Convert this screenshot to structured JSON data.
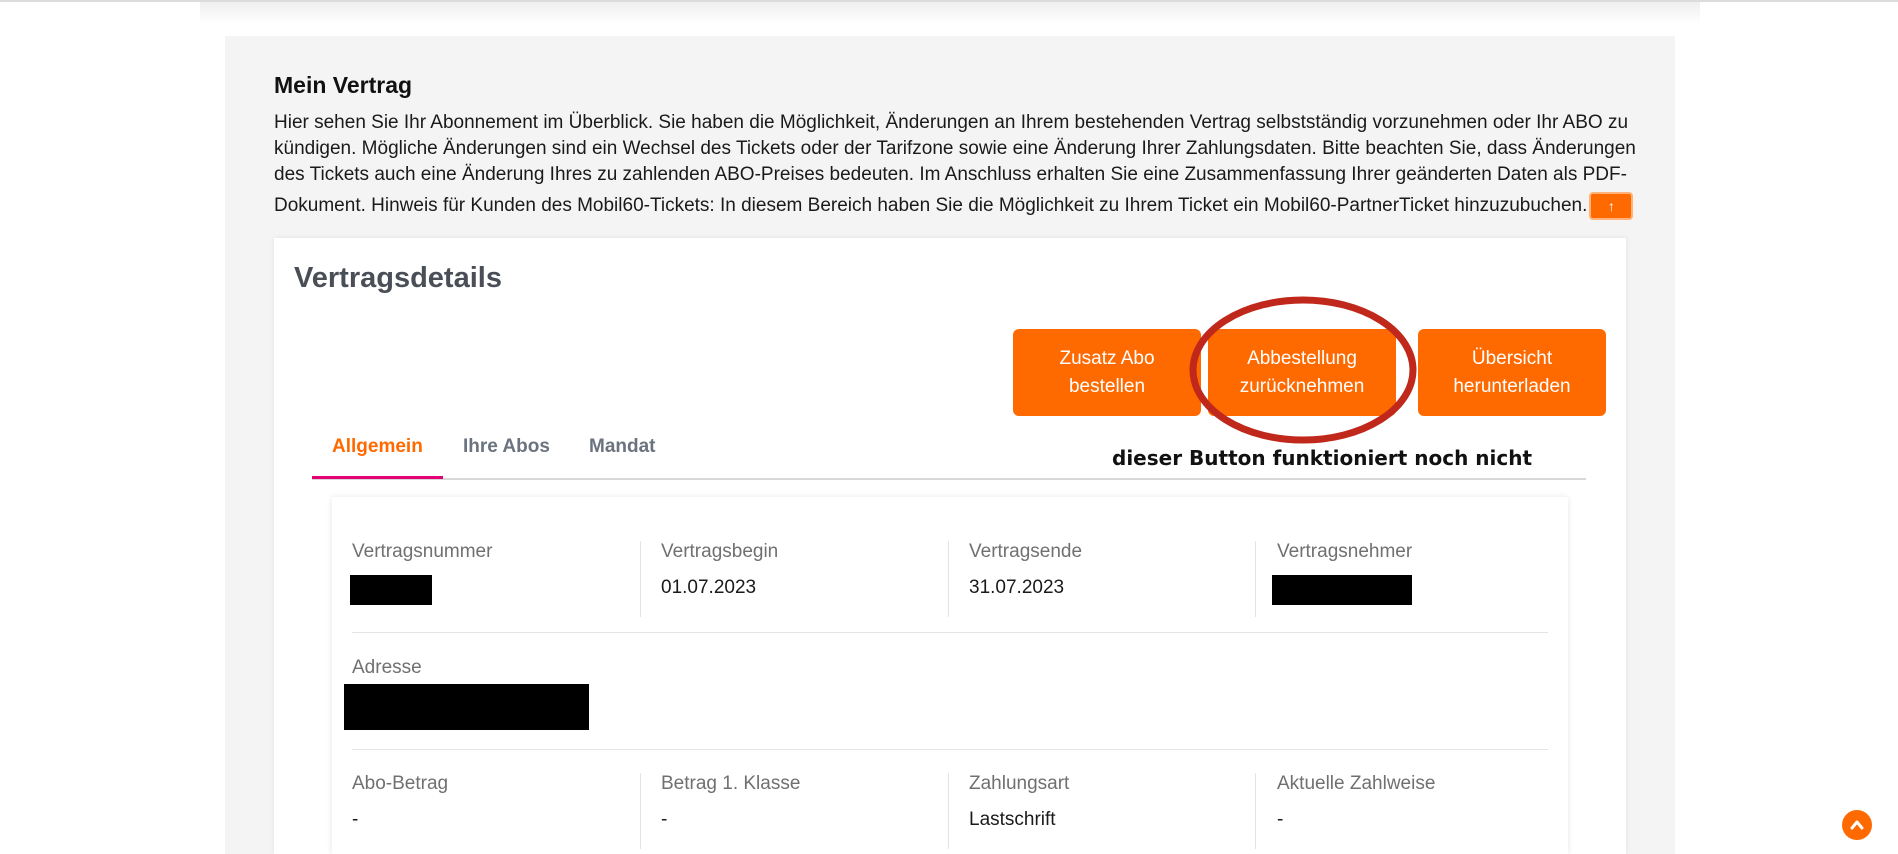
{
  "section": {
    "title": "Mein Vertrag",
    "intro_lines": [
      "Hier sehen Sie Ihr Abonnement im Überblick. Sie haben die Möglichkeit, Änderungen an Ihrem bestehenden Vertrag selbstständig vorzunehmen oder Ihr ABO zu",
      "kündigen. Mögliche Änderungen sind ein Wechsel des Tickets oder der Tarifzone sowie eine Änderung Ihrer Zahlungsdaten. Bitte beachten Sie, dass Änderungen",
      "des Tickets auch eine Änderung Ihres zu zahlenden ABO-Preises bedeuten. Im Anschluss erhalten Sie eine Zusammenfassung Ihrer geänderten Daten als PDF-",
      "Dokument. Hinweis für Kunden des Mobil60-Tickets: In diesem Bereich haben Sie die Möglichkeit zu Ihrem Ticket ein Mobil60-PartnerTicket hinzuzubuchen."
    ],
    "up_button_glyph": "↑"
  },
  "card": {
    "title": "Vertragsdetails",
    "buttons": {
      "zusatz_abo": "Zusatz Abo bestellen",
      "abbestellung": "Abbestellung zurücknehmen",
      "uebersicht": "Übersicht herunterladen"
    },
    "annotation": "dieser Button funktioniert noch nicht"
  },
  "tabs": [
    "Allgemein",
    "Ihre Abos",
    "Mandat"
  ],
  "details": {
    "row1": [
      {
        "label": "Vertragsnummer",
        "value": ""
      },
      {
        "label": "Vertragsbegin",
        "value": "01.07.2023"
      },
      {
        "label": "Vertragsende",
        "value": "31.07.2023"
      },
      {
        "label": "Vertragsnehmer",
        "value": ""
      }
    ],
    "row2": [
      {
        "label": "Adresse",
        "value": ""
      }
    ],
    "row3": [
      {
        "label": "Abo-Betrag",
        "value": "-"
      },
      {
        "label": "Betrag 1. Klasse",
        "value": "-"
      },
      {
        "label": "Zahlungsart",
        "value": "Lastschrift"
      },
      {
        "label": "Aktuelle Zahlweise",
        "value": "-"
      }
    ]
  },
  "colors": {
    "accent": "#ff6a00",
    "tab_underline": "#e20074",
    "annotation_ring": "#c0281b"
  },
  "icons": {
    "scroll_top": "chevron-up-icon"
  },
  "scroll_top_glyph": "⌃"
}
